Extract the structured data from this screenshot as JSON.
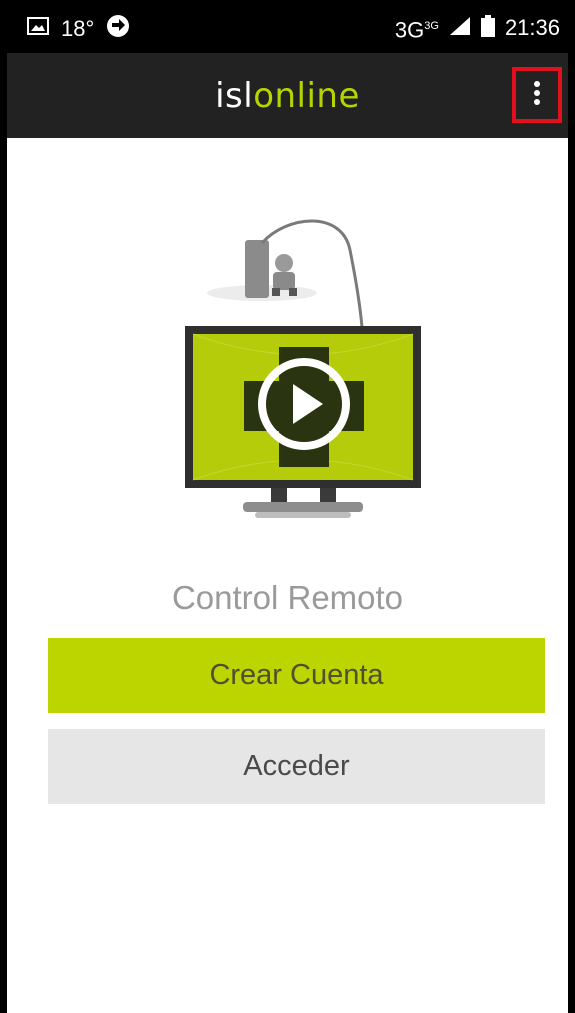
{
  "status_bar": {
    "temperature": "18°",
    "network": "3G",
    "network_superscript": "3G",
    "time": "21:36"
  },
  "app_bar": {
    "logo_part1": "isl",
    "logo_part2": "online",
    "menu_icon": "more-vert-icon"
  },
  "main": {
    "title": "Control Remoto",
    "primary_button": "Crear Cuenta",
    "secondary_button": "Acceder"
  },
  "colors": {
    "accent": "#bcd400",
    "appbar": "#222222",
    "highlight": "#e0101e"
  }
}
